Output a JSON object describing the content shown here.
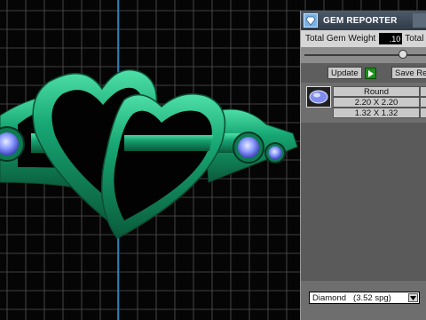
{
  "panel": {
    "title": "GEM REPORTER",
    "total_gem_weight_label": "Total Gem Weight",
    "total_gem_weight_value": ".10",
    "total_second_label": "Total",
    "update_label": "Update",
    "save_label": "Save Re"
  },
  "table": {
    "header": "Round",
    "rows": [
      "2.20 X 2.20",
      "1.32 X 1.32"
    ]
  },
  "material": {
    "name": "Diamond",
    "spg": "(3.52 spg)"
  },
  "colors": {
    "ring": "#149062",
    "ring_dark": "#0a4d34",
    "grid": "#555555",
    "axis": "#2a8fd6",
    "gem": "#6c7ef0"
  },
  "icons": {
    "app": "gem-reporter-icon",
    "go": "green-play-icon",
    "dropdown": "dropdown-arrow-icon",
    "gem": "round-gem-icon"
  }
}
